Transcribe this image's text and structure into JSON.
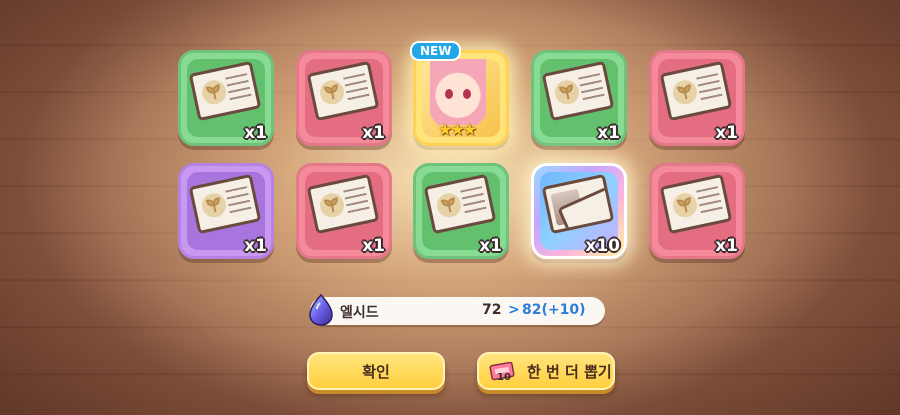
{
  "rewards": [
    {
      "type": "ticket",
      "frame": "green",
      "count": "x1"
    },
    {
      "type": "ticket",
      "frame": "pink",
      "count": "x1"
    },
    {
      "type": "character",
      "frame": "yellow",
      "badge": "NEW",
      "stars": "★★★"
    },
    {
      "type": "ticket",
      "frame": "green",
      "count": "x1"
    },
    {
      "type": "ticket",
      "frame": "pink",
      "count": "x1"
    },
    {
      "type": "ticket",
      "frame": "purple",
      "count": "x1"
    },
    {
      "type": "ticket",
      "frame": "pink",
      "count": "x1"
    },
    {
      "type": "ticket",
      "frame": "green",
      "count": "x1"
    },
    {
      "type": "photo-ticket",
      "frame": "rainbow",
      "count": "x10"
    },
    {
      "type": "ticket",
      "frame": "pink",
      "count": "x1"
    }
  ],
  "elseed": {
    "label": "엘시드",
    "old": "72",
    "arrow": ">",
    "new": "82(+10)",
    "icon": "elseed-gem-icon"
  },
  "buttons": {
    "confirm": "확인",
    "again": "한 번 더 뽑기",
    "again_ticket_count": "10"
  },
  "colors": {
    "green": "#87db93",
    "pink": "#f48a9a",
    "purple": "#c999f2",
    "yellow": "#ffe47a",
    "button": "#ffd84f",
    "accent_blue": "#2e7dd7"
  }
}
